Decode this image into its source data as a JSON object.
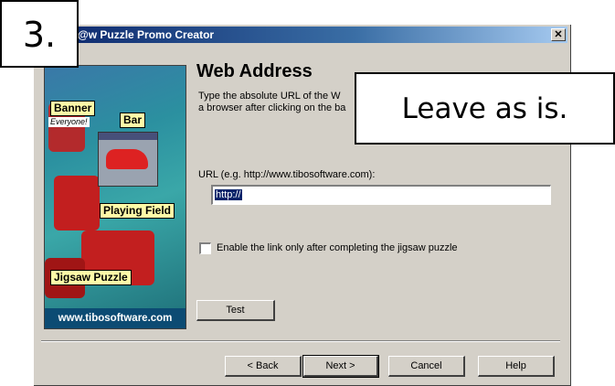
{
  "window": {
    "title": "@w Puzzle Promo Creator",
    "close_glyph": "✕"
  },
  "side_panel": {
    "labels": {
      "banner": "Banner",
      "everyone": "Everyone!",
      "bar": "Bar",
      "playing_field": "Playing Field",
      "jigsaw_puzzle": "Jigsaw Puzzle"
    },
    "footer": "www.tibosoftware.com"
  },
  "content": {
    "heading": "Web Address",
    "description_line1": "Type the absolute URL of the W",
    "description_line2": "a browser after clicking on the ba",
    "url_label": "URL (e.g. http://www.tibosoftware.com):",
    "url_value": "http://",
    "enable_label": "Enable the link only after completing the jigsaw puzzle",
    "enable_checked": false,
    "test_label": "Test"
  },
  "footer_buttons": {
    "back": "< Back",
    "next": "Next >",
    "cancel": "Cancel",
    "help": "Help"
  },
  "callouts": {
    "step": "3.",
    "note": "Leave as is."
  }
}
